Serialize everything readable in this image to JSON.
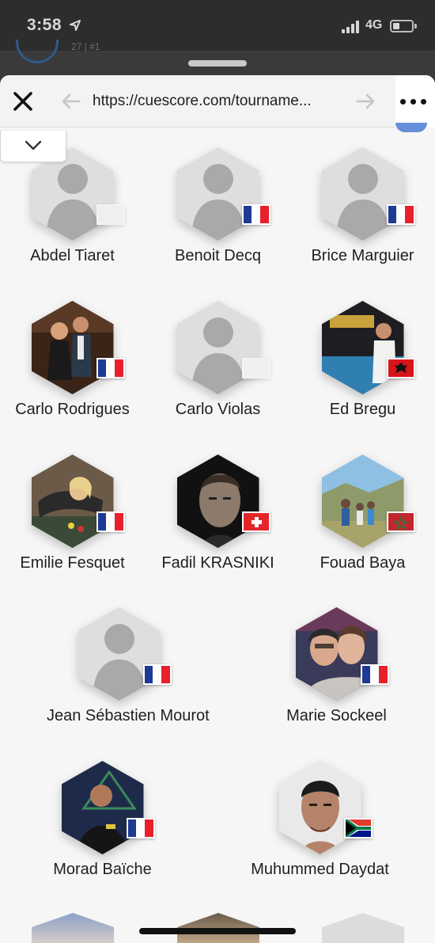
{
  "status_bar": {
    "time": "3:58",
    "network": "4G"
  },
  "background_page": {
    "text": "27 | #1"
  },
  "browser": {
    "url": "https://cuescore.com/tourname..."
  },
  "players": [
    {
      "name": "Abdel Tiaret",
      "photo": "placeholder",
      "flag": "none"
    },
    {
      "name": "Benoit Decq",
      "photo": "placeholder",
      "flag": "france"
    },
    {
      "name": "Brice Marguier",
      "photo": "placeholder",
      "flag": "france"
    },
    {
      "name": "Carlo Rodrigues",
      "photo": "party-photo",
      "flag": "france"
    },
    {
      "name": "Carlo Violas",
      "photo": "placeholder",
      "flag": "none"
    },
    {
      "name": "Ed Bregu",
      "photo": "predator-photo",
      "flag": "albania"
    },
    {
      "name": "Emilie Fesquet",
      "photo": "billiards-photo",
      "flag": "france"
    },
    {
      "name": "Fadil KRASNIKI",
      "photo": "portrait-bw",
      "flag": "switzerland"
    },
    {
      "name": "Fouad Baya",
      "photo": "family-outdoor",
      "flag": "morocco"
    },
    {
      "name": "Jean Sébastien Mourot",
      "photo": "placeholder",
      "flag": "france"
    },
    {
      "name": "Marie Sockeel",
      "photo": "selfie-photo",
      "flag": "france"
    },
    {
      "name": "Morad Baïche",
      "photo": "player-dark",
      "flag": "france"
    },
    {
      "name": "Muhummed Daydat",
      "photo": "portrait-color",
      "flag": "south-africa"
    }
  ],
  "colors": {
    "france_blue": "#1f3a93",
    "france_red": "#e8202a",
    "swiss_red": "#e4262a",
    "albania_red": "#d8141b",
    "morocco_red": "#c1272d",
    "sheet_bg": "#f6f6f6"
  }
}
